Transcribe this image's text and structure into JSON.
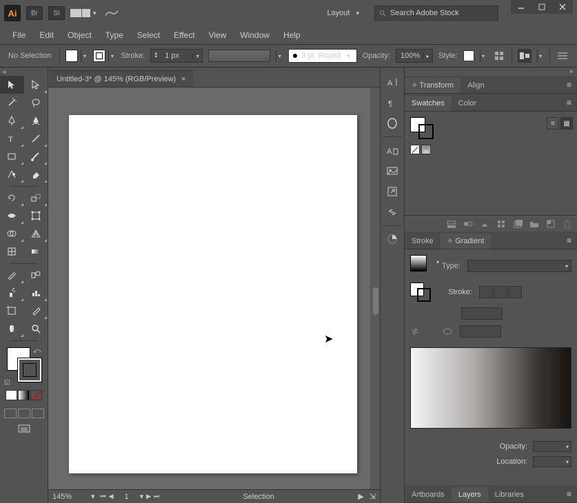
{
  "titlebar": {
    "logo": "Ai",
    "layout_label": "Layout",
    "search_placeholder": "Search Adobe Stock"
  },
  "menu": [
    "File",
    "Edit",
    "Object",
    "Type",
    "Select",
    "Effect",
    "View",
    "Window",
    "Help"
  ],
  "control": {
    "selection": "No Selection",
    "stroke_label": "Stroke:",
    "stroke_value": "1 px",
    "brush_label": "3 pt. Round",
    "opacity_label": "Opacity:",
    "opacity_value": "100%",
    "style_label": "Style:"
  },
  "document": {
    "tab_title": "Untitled-3* @ 145% (RGB/Preview)"
  },
  "status": {
    "zoom": "145%",
    "artboard": "1",
    "selection": "Selection"
  },
  "panels": {
    "transform": "Transform",
    "align": "Align",
    "swatches": "Swatches",
    "color": "Color",
    "stroke": "Stroke",
    "gradient": "Gradient",
    "artboards": "Artboards",
    "layers": "Layers",
    "libraries": "Libraries",
    "gradient_type": "Type:",
    "gradient_stroke": "Stroke:",
    "gradient_opacity": "Opacity:",
    "gradient_location": "Location:"
  }
}
